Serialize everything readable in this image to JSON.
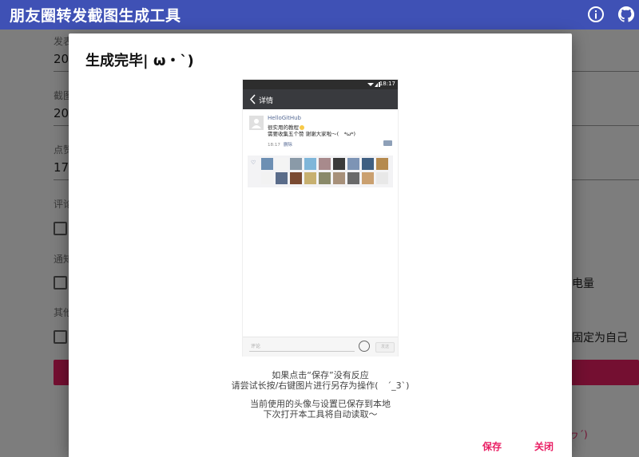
{
  "app": {
    "title": "朋友圈转发截图生成工具"
  },
  "form": {
    "label_publish": "发表",
    "value_publish": "20",
    "label_screenshot": "截图",
    "value_screenshot": "20",
    "label_likes": "点赞",
    "value_likes": "17",
    "label_comments": "评论",
    "label_notify": "通知",
    "label_other": "其他",
    "partial_battery": "电量",
    "partial_pin_self": "固定为自己",
    "partial_footer": "ヮ´)"
  },
  "dialog": {
    "title": "生成完毕| ω・`)",
    "hint1_line1": "如果点击“保存”没有反应",
    "hint1_line2": "请尝试长按/右键图片进行另存为操作(　´_3`)",
    "hint2_line1": "当前使用的头像与设置已保存到本地",
    "hint2_line2": "下次打开本工具将自动读取～",
    "save_label": "保存",
    "close_label": "关闭"
  },
  "phone": {
    "status_time": "18:17",
    "nav_title": "详情",
    "username": "HelloGitHub",
    "line1": "很实用的教程",
    "line2": "需要收集五个赞 谢谢大家啦～(　*ω*)",
    "post_time": "18:17",
    "delete_label": "删除",
    "comment_placeholder": "评论",
    "send_label": "发送",
    "like_thumb_colors": [
      "#6d8fb3",
      "#f4f4f4",
      "#8a9aa8",
      "#7fb6d9",
      "#a88a8c",
      "#3a3a3a",
      "#7d94b5",
      "#3f5f82",
      "#b58a4e",
      "#f2f2f2",
      "#5a6c8a",
      "#7a4a32",
      "#c7b070",
      "#8a8a6a",
      "#a7907a",
      "#6a6a6a",
      "#caa070",
      "#e8e8e8"
    ]
  },
  "colors": {
    "appbar": "#3f51b5",
    "accent": "#e91e63"
  }
}
